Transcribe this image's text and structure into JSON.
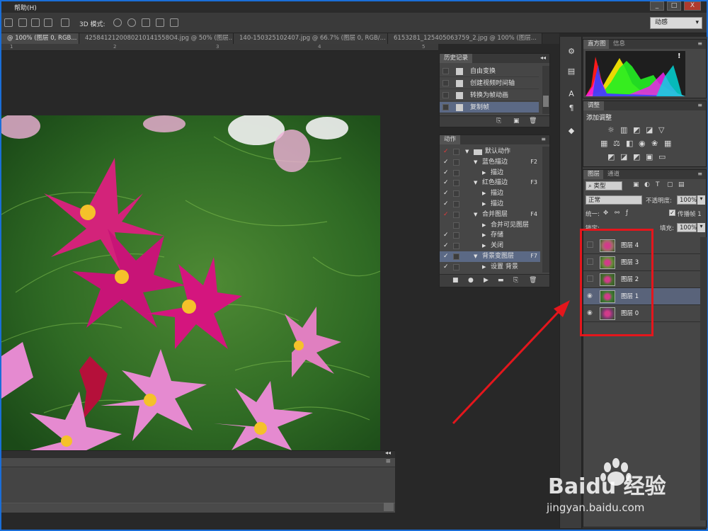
{
  "menubar": {
    "help": "帮助(H)"
  },
  "window": {
    "btn_min": "_",
    "btn_max": "□",
    "btn_close": "X"
  },
  "options": {
    "mode_label": "3D 模式:",
    "workspace": "动感"
  },
  "tabs": [
    {
      "label": "@ 100% (图层 0, RGB..."
    },
    {
      "label": "4258412120080210141558O4.jpg @ 50% (图层..."
    },
    {
      "label": "140-150325102407.jpg @ 66.7% (图层 0, RGB/..."
    },
    {
      "label": "6153281_125405063759_2.jpg @ 100% (图层..."
    }
  ],
  "ruler": {
    "labels": [
      "1",
      "2",
      "3",
      "4",
      "5"
    ]
  },
  "history": {
    "title": "历史记录",
    "items": [
      "自由变换",
      "创建视频时间轴",
      "转换为帧动画",
      "复制帧"
    ]
  },
  "actions": {
    "title": "动作",
    "items": [
      {
        "label": "默认动作",
        "level": 0,
        "check": "red",
        "key": ""
      },
      {
        "label": "蓝色描边",
        "level": 1,
        "check": "white",
        "key": "F2"
      },
      {
        "label": "描边",
        "level": 2,
        "check": "white",
        "key": ""
      },
      {
        "label": "红色描边",
        "level": 1,
        "check": "white",
        "key": "F3"
      },
      {
        "label": "描边",
        "level": 2,
        "check": "white",
        "key": ""
      },
      {
        "label": "描边",
        "level": 2,
        "check": "white",
        "key": ""
      },
      {
        "label": "合并图层",
        "level": 1,
        "check": "red",
        "key": "F4"
      },
      {
        "label": "合并可见图层",
        "level": 2,
        "check": "none",
        "key": ""
      },
      {
        "label": "存储",
        "level": 2,
        "check": "white",
        "key": ""
      },
      {
        "label": "关闭",
        "level": 2,
        "check": "white",
        "key": ""
      },
      {
        "label": "背景变图层",
        "level": 1,
        "check": "white",
        "key": "F7"
      },
      {
        "label": "设置 背景",
        "level": 2,
        "check": "white",
        "key": ""
      }
    ]
  },
  "histogram": {
    "tab1": "直方图",
    "tab2": "信息",
    "warning": "!"
  },
  "adjustments": {
    "title": "调整",
    "add_label": "添加调整"
  },
  "layers": {
    "tab1": "图层",
    "tab2": "通道",
    "filter": "类型",
    "blend_mode": "正常",
    "opacity_label": "不透明度:",
    "opacity": "100%",
    "unify_label": "统一:",
    "propagate_label": "传播帧 1",
    "lock_label": "锁定:",
    "fill_label": "填充:",
    "fill": "100%",
    "items": [
      {
        "name": "图层 4",
        "visible": false,
        "selected": false,
        "color": "#a46a6a"
      },
      {
        "name": "图层 3",
        "visible": false,
        "selected": false,
        "color": "#6c8a3c"
      },
      {
        "name": "图层 2",
        "visible": false,
        "selected": false,
        "color": "#4a6a30"
      },
      {
        "name": "图层 1",
        "visible": true,
        "selected": true,
        "color": "#3f7a34"
      },
      {
        "name": "图层 0",
        "visible": true,
        "selected": false,
        "color": "#7a3a6e"
      }
    ]
  },
  "watermark": {
    "brand": "Baidu 经验",
    "url": "jingyan.baidu.com"
  }
}
